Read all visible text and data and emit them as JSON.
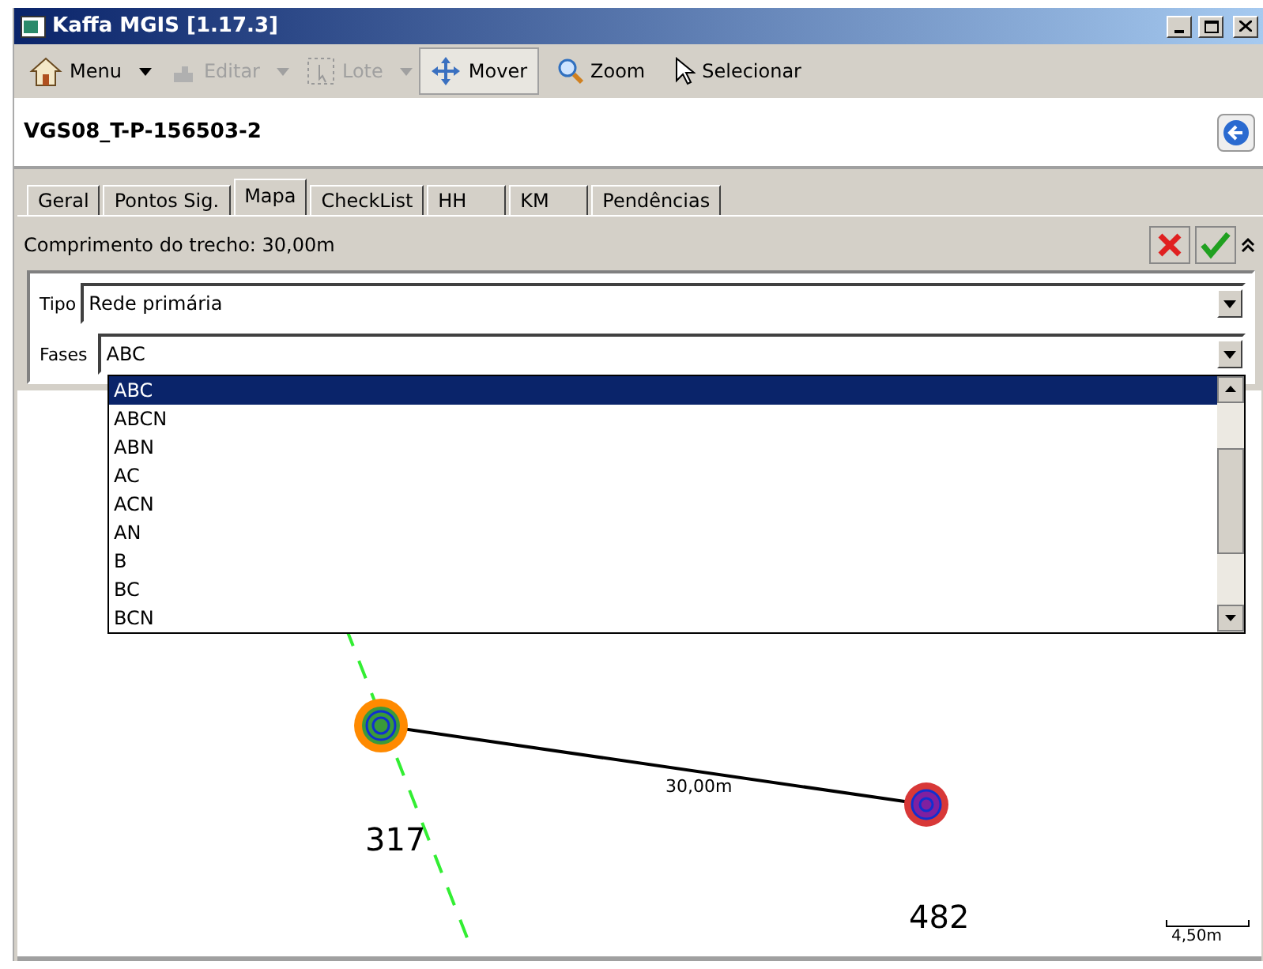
{
  "window": {
    "title": "Kaffa MGIS [1.17.3]"
  },
  "toolbar": [
    {
      "label": "Menu",
      "disabled": false,
      "selected": false,
      "dropdown": true
    },
    {
      "label": "Editar",
      "disabled": true,
      "selected": false,
      "dropdown": true
    },
    {
      "label": "Lote",
      "disabled": true,
      "selected": false,
      "dropdown": true
    },
    {
      "label": "Mover",
      "disabled": false,
      "selected": true,
      "dropdown": false
    },
    {
      "label": "Zoom",
      "disabled": false,
      "selected": false,
      "dropdown": false
    },
    {
      "label": "Selecionar",
      "disabled": false,
      "selected": false,
      "dropdown": false
    }
  ],
  "record": {
    "title": "VGS08_T-P-156503-2"
  },
  "tabs": [
    {
      "label": "Geral",
      "selected": false
    },
    {
      "label": "Pontos Sig.",
      "selected": false
    },
    {
      "label": "Mapa",
      "selected": true
    },
    {
      "label": "CheckList",
      "selected": false
    },
    {
      "label": "HH",
      "selected": false
    },
    {
      "label": "KM",
      "selected": false
    },
    {
      "label": "Pendências",
      "selected": false
    }
  ],
  "length_label": "Comprimento do trecho: 30,00m",
  "form": [
    {
      "label": "Tipo",
      "value": "Rede primária",
      "open": false
    },
    {
      "label": "Fases",
      "value": "ABC",
      "open": true
    }
  ],
  "dropdown_options": [
    {
      "label": "ABC",
      "selected": true
    },
    {
      "label": "ABCN",
      "selected": false
    },
    {
      "label": "ABN",
      "selected": false
    },
    {
      "label": "AC",
      "selected": false
    },
    {
      "label": "ACN",
      "selected": false
    },
    {
      "label": "AN",
      "selected": false
    },
    {
      "label": "B",
      "selected": false
    },
    {
      "label": "BC",
      "selected": false
    },
    {
      "label": "BCN",
      "selected": false
    }
  ],
  "map": {
    "segment_label": "30,00m",
    "point_labels": [
      "317",
      "482"
    ],
    "scale_label": "4,50m"
  }
}
